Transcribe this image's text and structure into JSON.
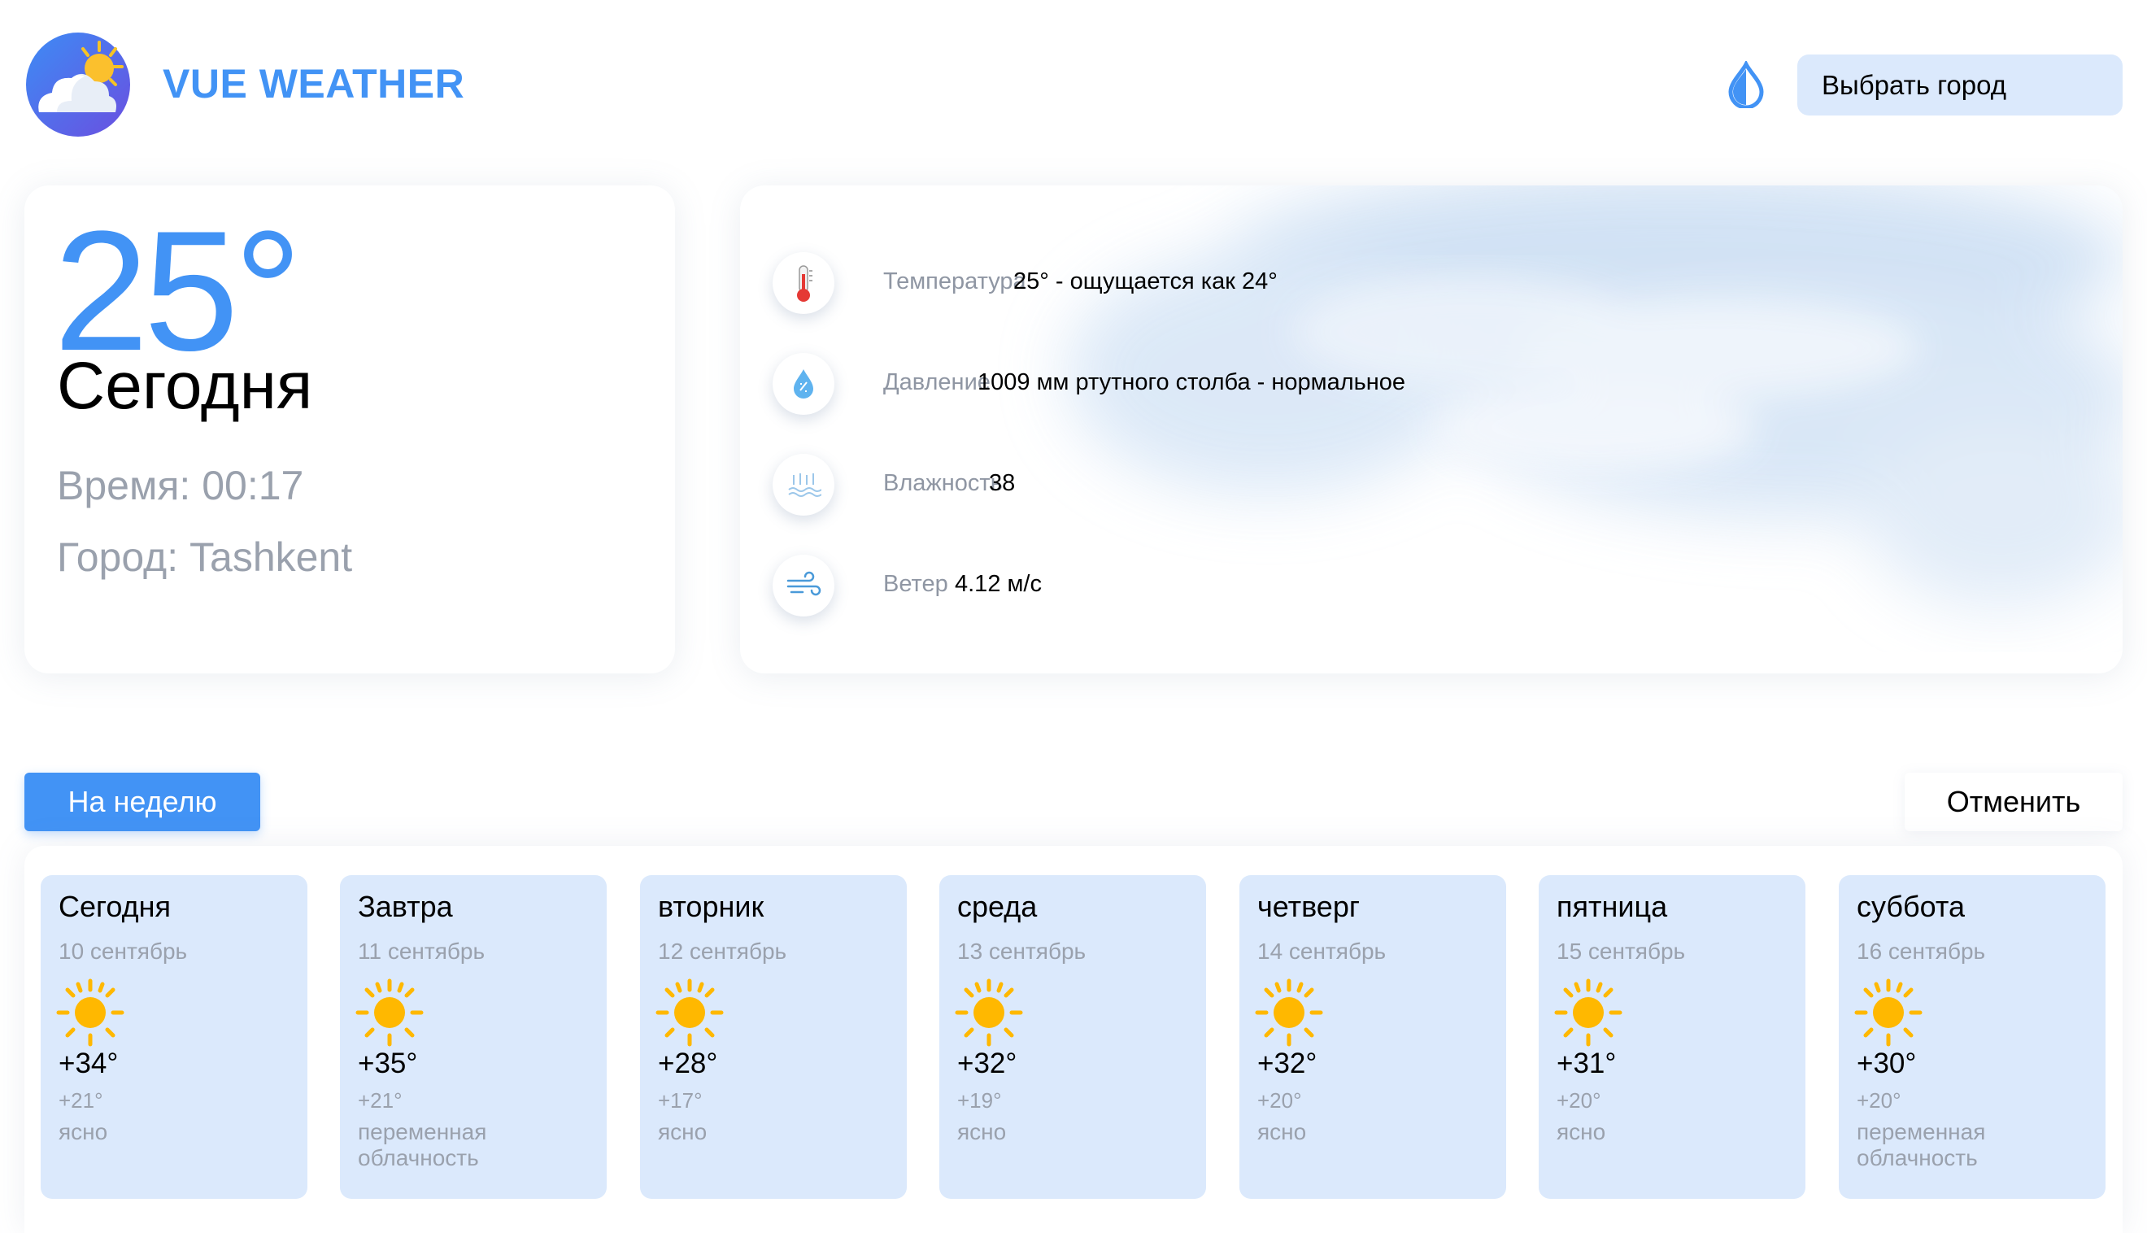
{
  "header": {
    "app_name": "VUE WEATHER",
    "logo_icon": "cloud-sun-icon",
    "theme_icon": "water-drop-icon",
    "select_city_label": "Выбрать город"
  },
  "today": {
    "temperature": "25°",
    "label": "Сегодня",
    "time": "Время: 00:17",
    "city": "Город: Tashkent"
  },
  "details": [
    {
      "icon": "thermometer-icon",
      "label": "Температура",
      "value": "25° - ощущается как 24°"
    },
    {
      "icon": "pressure-drop-icon",
      "label": "Давление",
      "value": "1009 мм ртутного столба - нормальное"
    },
    {
      "icon": "humidity-icon",
      "label": "Влажность",
      "value": "38"
    },
    {
      "icon": "wind-icon",
      "label": "Ветер",
      "value": "4.12 м/с"
    }
  ],
  "week": {
    "week_button_label": "На неделю",
    "cancel_button_label": "Отменить",
    "days": [
      {
        "name": "Сегодня",
        "date": "10 сентябрь",
        "icon": "sun-icon",
        "high": "+34°",
        "low": "+21°",
        "desc": "ясно"
      },
      {
        "name": "Завтра",
        "date": "11 сентябрь",
        "icon": "sun-icon",
        "high": "+35°",
        "low": "+21°",
        "desc": "переменная облачность"
      },
      {
        "name": "вторник",
        "date": "12 сентябрь",
        "icon": "sun-icon",
        "high": "+28°",
        "low": "+17°",
        "desc": "ясно"
      },
      {
        "name": "среда",
        "date": "13 сентябрь",
        "icon": "sun-icon",
        "high": "+32°",
        "low": "+19°",
        "desc": "ясно"
      },
      {
        "name": "четверг",
        "date": "14 сентябрь",
        "icon": "sun-icon",
        "high": "+32°",
        "low": "+20°",
        "desc": "ясно"
      },
      {
        "name": "пятница",
        "date": "15 сентябрь",
        "icon": "sun-icon",
        "high": "+31°",
        "low": "+20°",
        "desc": "ясно"
      },
      {
        "name": "суббота",
        "date": "16 сентябрь",
        "icon": "sun-icon",
        "high": "+30°",
        "low": "+20°",
        "desc": "переменная облачность"
      }
    ]
  },
  "colors": {
    "accent": "#4293f5",
    "card_blue": "#dbe9fc",
    "muted_text": "#9aa1ad",
    "sun": "#ffb800"
  }
}
